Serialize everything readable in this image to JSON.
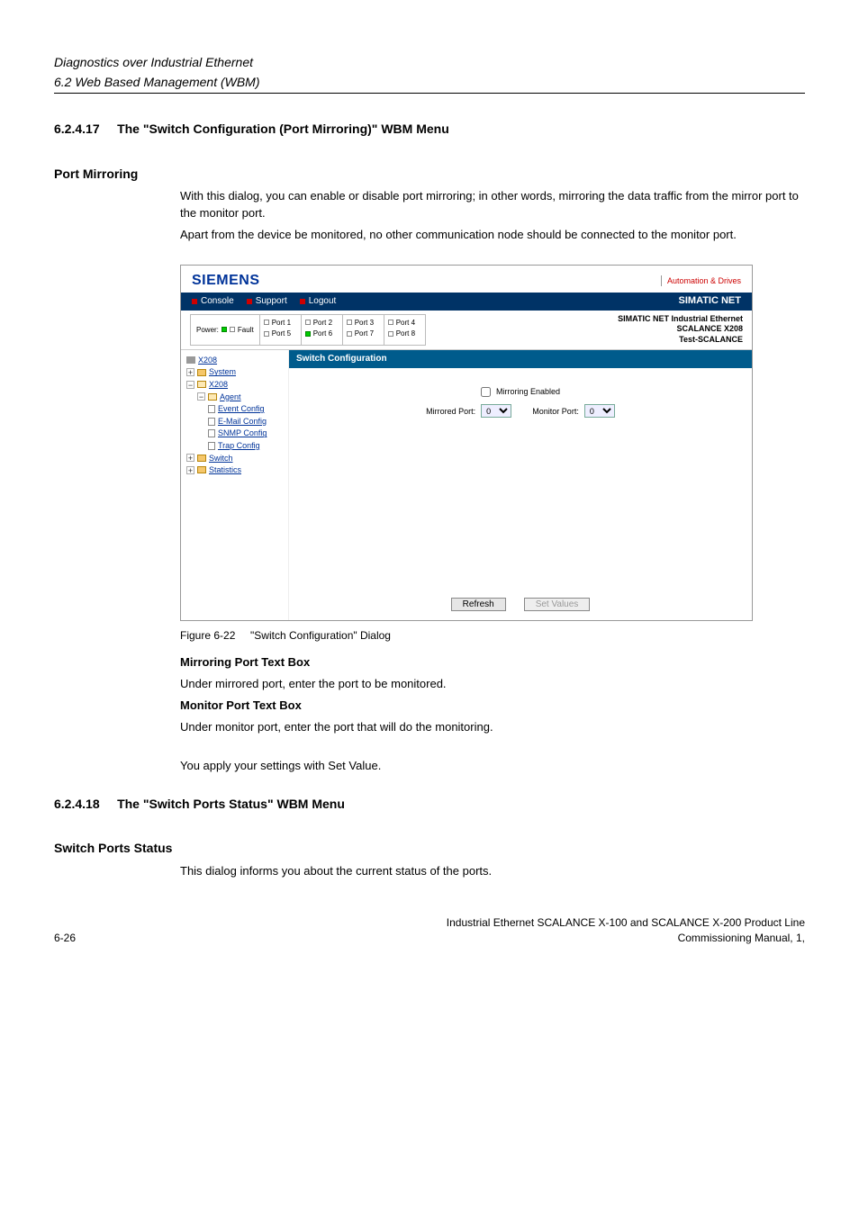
{
  "header": {
    "title_italic": "Diagnostics over Industrial Ethernet",
    "subtitle_italic": "6.2 Web Based Management (WBM)"
  },
  "section1": {
    "number": "6.2.4.17",
    "title": "The \"Switch Configuration (Port Mirroring)\" WBM Menu",
    "pm_heading": "Port Mirroring",
    "para1": "With this dialog, you can enable or disable port mirroring; in other words, mirroring the data traffic from the mirror port to the monitor port.",
    "para2": "Apart from the device be monitored, no other communication node should be connected to the monitor port."
  },
  "screenshot": {
    "brand": "SIEMENS",
    "tagline": "Automation & Drives",
    "nav": {
      "console": "Console",
      "support": "Support",
      "logout": "Logout",
      "net": "SIMATIC NET"
    },
    "power_label": "Power:",
    "fault_label": "Fault",
    "ports": [
      {
        "a": "Port 1",
        "b": "Port 5"
      },
      {
        "a": "Port 2",
        "b": "Port 6"
      },
      {
        "a": "Port 3",
        "b": "Port 7"
      },
      {
        "a": "Port 4",
        "b": "Port 8"
      }
    ],
    "meta": {
      "l1": "SIMATIC NET Industrial Ethernet",
      "l2": "SCALANCE X208",
      "l3": "Test-SCALANCE"
    },
    "tree": {
      "root": "X208",
      "system": "System",
      "x208": "X208",
      "agent": "Agent",
      "event": "Event Config",
      "email": "E-Mail Config",
      "snmp": "SNMP Config",
      "trap": "Trap Config",
      "switch": "Switch",
      "stats": "Statistics"
    },
    "pane_title": "Switch Configuration",
    "form": {
      "mirroring_enabled": "Mirroring Enabled",
      "mirrored_port": "Mirrored Port:",
      "monitor_port": "Monitor Port:",
      "mirrored_val": "0",
      "monitor_val": "0"
    },
    "buttons": {
      "refresh": "Refresh",
      "set": "Set Values"
    }
  },
  "figure_caption_label": "Figure 6-22",
  "figure_caption_text": "\"Switch Configuration\" Dialog",
  "post_figure": {
    "h1": "Mirroring Port Text Box",
    "p1": "Under mirrored port, enter the port to be monitored.",
    "h2": "Monitor Port Text Box",
    "p2": "Under monitor port, enter the port that will do the monitoring.",
    "p3": "You apply your settings with Set Value."
  },
  "section2": {
    "number": "6.2.4.18",
    "title": "The \"Switch Ports Status\" WBM Menu",
    "sub_heading": "Switch Ports Status",
    "para": "This dialog informs you about the current status of the ports."
  },
  "footer": {
    "page": "6-26",
    "r1": "Industrial Ethernet SCALANCE X-100 and SCALANCE X-200 Product Line",
    "r2": "Commissioning Manual, 1,"
  }
}
